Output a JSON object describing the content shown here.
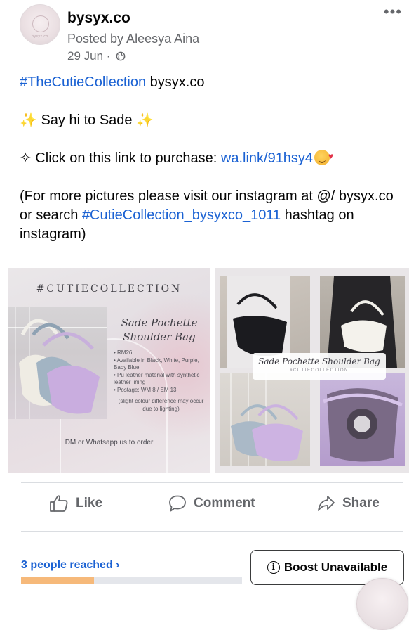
{
  "post": {
    "page_name": "bysyx.co",
    "posted_by": "Posted by Aleesya Aina",
    "date": "29 Jun",
    "date_sep": " · ",
    "more_label": "•••",
    "avatar_text": "bysyx.co",
    "privacy_icon": "globe-icon"
  },
  "body": {
    "hashtag": "#TheCutieCollection",
    "hashtag_suffix": " bysyx.co",
    "sparkle": "✨",
    "greeting": " Say hi to Sade ",
    "link_prefix": "✧ Click on this link to purchase: ",
    "link": "wa.link/91hsy4",
    "emoji": "smiling-face-with-hearts",
    "more_info_1": "(For more pictures please visit our instagram at @/ bysyx.co or search ",
    "more_info_hashtag": "#CutieCollection_bysyxco_1011",
    "more_info_2": " hashtag on instagram)"
  },
  "image_left": {
    "title": "#CUTIECOLLECTION",
    "product_line1": "Sade Pochette",
    "product_line2": "Shoulder Bag",
    "details": [
      "• RM26",
      "• Available in Black, White, Purple, Baby Blue",
      "• Pu leather material with synthetic leather lining",
      "• Postage: WM 8 / EM 13"
    ],
    "note": "(slight colour difference may occur due to lighting)",
    "cta": "DM or Whatsapp us to order"
  },
  "image_right": {
    "banner_title": "Sade Pochette Shoulder Bag",
    "banner_sub": "#CUTIECOLLECTION"
  },
  "actions": {
    "like": "Like",
    "comment": "Comment",
    "share": "Share"
  },
  "insights": {
    "reached": "3 people reached",
    "reached_chevron": "›",
    "progress": 0.33,
    "boost_label": "Boost Unavailable",
    "boost_icon": "info-icon"
  },
  "colors": {
    "link": "#1b62d3",
    "secondary_text": "#65676b",
    "progress_fill": "#f6b97a",
    "progress_track": "#e4e6eb"
  }
}
